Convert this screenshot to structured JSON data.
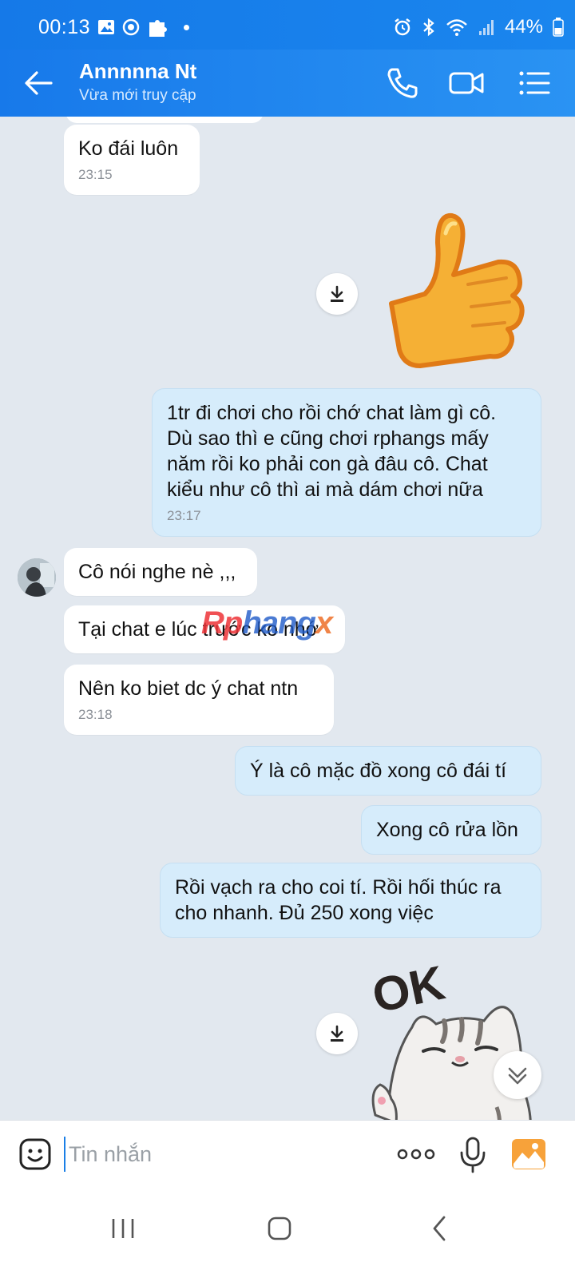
{
  "status_bar": {
    "time": "00:13",
    "battery": "44%",
    "icons_left": [
      "image-icon",
      "sync-icon",
      "puzzle-icon"
    ],
    "icons_right": [
      "alarm-icon",
      "bluetooth-icon",
      "wifi-icon",
      "signal-icon",
      "battery-icon"
    ]
  },
  "header": {
    "contact_name": "Annnnna Nt",
    "status": "Vừa mới truy cập",
    "actions": [
      "phone-call-icon",
      "video-call-icon",
      "menu-icon"
    ]
  },
  "messages": [
    {
      "side": "in",
      "text": "Ko đái luôn",
      "time": "23:15"
    },
    {
      "side": "out",
      "type": "sticker",
      "sticker": "thumbs-up"
    },
    {
      "side": "out",
      "lines": [
        "1tr đi chơi cho rồi chớ chat làm gì cô.",
        "Dù sao thì e cũng chơi rphangs mấy",
        "năm rồi ko phải con gà đâu cô. Chat",
        "kiểu như cô thì ai mà dám chơi nữa"
      ],
      "time": "23:17"
    },
    {
      "side": "in",
      "text": "Cô nói nghe nè ,,,"
    },
    {
      "side": "in",
      "text": "Tại chat e lúc trước ko nhớ"
    },
    {
      "side": "in",
      "text": "Nên ko biet dc ý chat ntn",
      "time": "23:18"
    },
    {
      "side": "out",
      "text": "Ý là cô mặc đồ xong cô đái tí"
    },
    {
      "side": "out",
      "text": "Xong cô rửa lồn"
    },
    {
      "side": "out",
      "lines": [
        "Rồi vạch ra cho coi tí. Rồi hối thúc ra",
        "cho nhanh. Đủ 250 xong việc"
      ]
    },
    {
      "side": "out",
      "type": "sticker",
      "sticker": "ok-cat",
      "sticker_text": "OK"
    }
  ],
  "watermark": {
    "part1": "Rp",
    "part2": "hang",
    "part3": "x"
  },
  "input": {
    "placeholder": "Tin nhắn"
  },
  "colors": {
    "header": "#1a86ee",
    "bubble_out": "#d6ecfb",
    "bubble_in": "#ffffff",
    "background": "#e2e8ef"
  }
}
